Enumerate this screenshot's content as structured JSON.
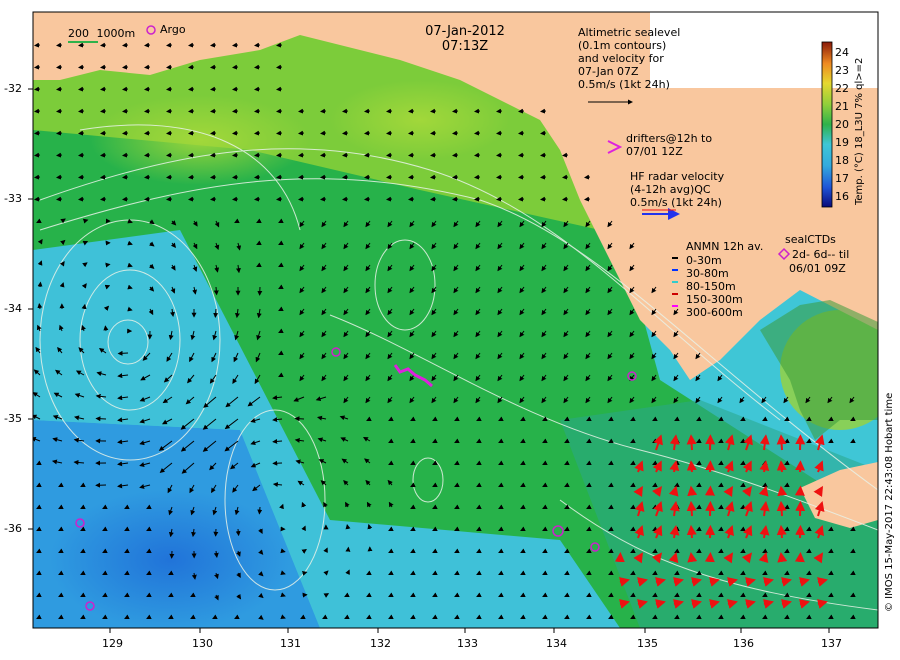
{
  "title": {
    "date": "07-Jan-2012",
    "time": "07:13Z"
  },
  "scale_legend": {
    "depth_200": "200",
    "depth_1000": "1000m",
    "argo": "Argo"
  },
  "altimetry_note": {
    "line1": "Altimetric sealevel",
    "line2": "(0.1m contours)",
    "line3": "and velocity for",
    "line4": "07-Jan 07Z",
    "line5": "0.5m/s (1kt 24h)"
  },
  "drifters_note": {
    "line1": "drifters@12h to",
    "line2": "07/01 12Z",
    "symbol": ">"
  },
  "hf_radar_note": {
    "line1": "HF radar velocity",
    "line2": "(4-12h avg)QC",
    "line3": "0.5m/s (1kt 24h)"
  },
  "anmn_legend": {
    "title": "ANMN 12h av.",
    "items": [
      {
        "label": "0-30m",
        "color": "#000000"
      },
      {
        "label": "30-80m",
        "color": "#0033ff"
      },
      {
        "label": "80-150m",
        "color": "#33cccc"
      },
      {
        "label": "150-300m",
        "color": "#cc0000"
      },
      {
        "label": "300-600m",
        "color": "#ff00ff"
      }
    ]
  },
  "sealctds": {
    "line1": "sealCTDs",
    "line2": "2d- 6d-- til",
    "line3": "06/01 09Z"
  },
  "colorbar": {
    "ticks": [
      "24",
      "23",
      "22",
      "21",
      "20",
      "19",
      "18",
      "17",
      "16"
    ],
    "label": "Temp. (°C) 18_L3U 7% ql>=2",
    "min": 15.5,
    "max": 24.5
  },
  "credit": "© IMOS 15-May-2017 22:43:08 Hobart time",
  "axes": {
    "x_ticks": [
      "129",
      "130",
      "131",
      "132",
      "133",
      "134",
      "135",
      "136",
      "137"
    ],
    "y_ticks": [
      "-32",
      "-33",
      "-34",
      "-35",
      "-36"
    ]
  },
  "colors": {
    "land": "#f9c79e",
    "warm": "#7ccc3a",
    "mid": "#27b24a",
    "cool": "#3fc6d6",
    "cold": "#2f9be0",
    "hf_arrow": "#ee1111",
    "argo": "#cc22cc",
    "contour": "#e8f2e8"
  }
}
